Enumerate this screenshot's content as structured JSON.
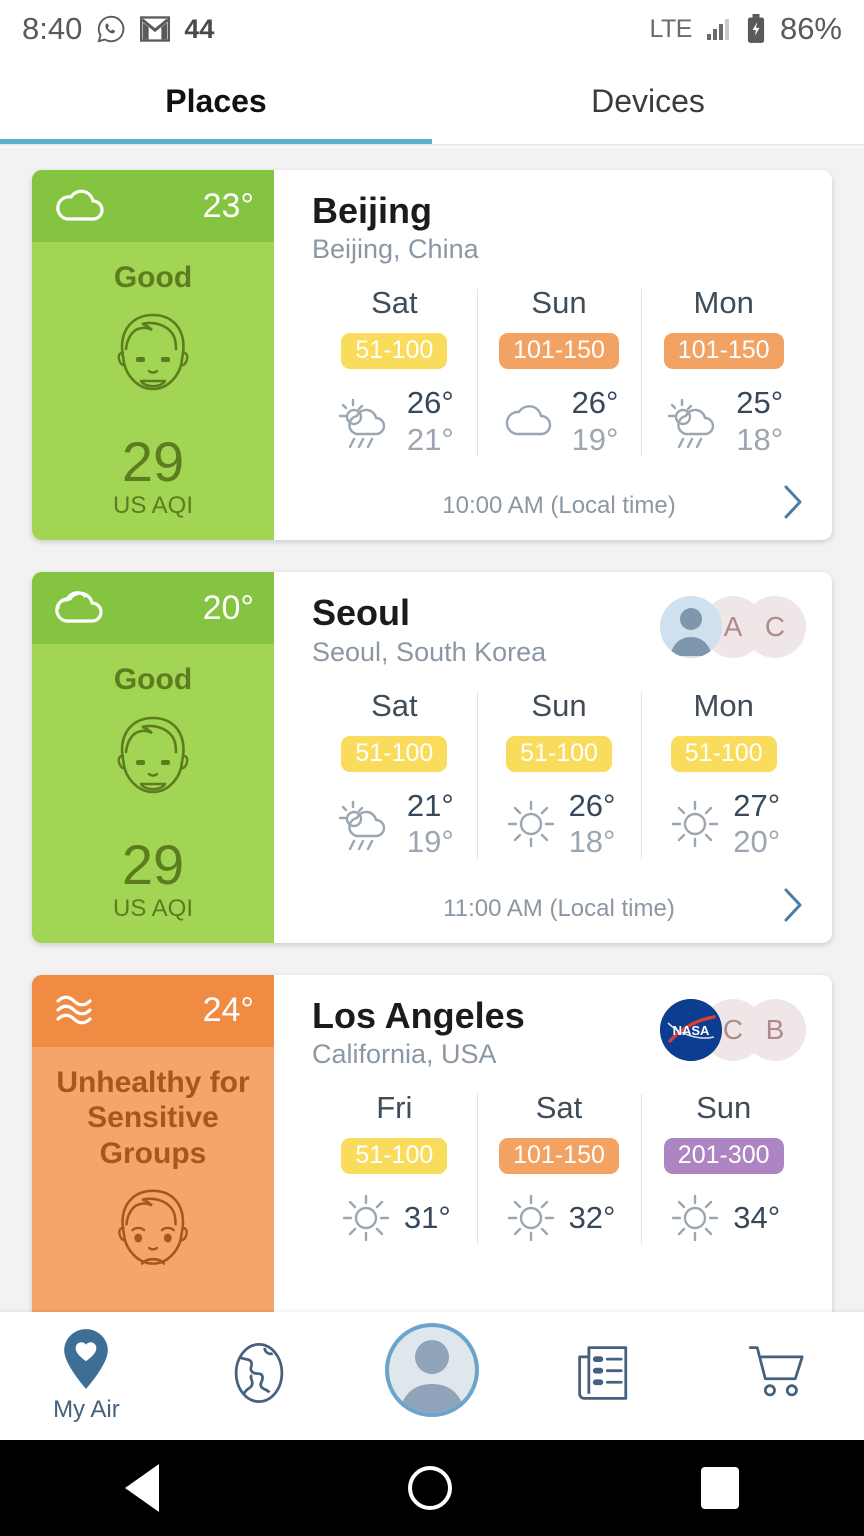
{
  "statusbar": {
    "time": "8:40",
    "notif_count": "44",
    "network": "LTE",
    "battery": "86%",
    "icons": [
      "whatsapp-icon",
      "gmail-icon",
      "signal-icon",
      "battery-charging-icon"
    ]
  },
  "tabs": [
    {
      "label": "Places",
      "active": true
    },
    {
      "label": "Devices",
      "active": false
    }
  ],
  "colors": {
    "tab_underline": "#5BAFC9",
    "good_header": "#84c440",
    "good_body": "#a2d554",
    "good_text": "#5d7c1f",
    "usg_header": "#f08b43",
    "usg_body": "#f6a56a",
    "usg_text": "#a8561d",
    "badge_yellow": "#f9dc5c",
    "badge_orange": "#f2a263",
    "badge_purple": "#ad85c2",
    "nav_blue": "#45617d"
  },
  "cards": [
    {
      "city": "Beijing",
      "region": "Beijing, China",
      "aqi": {
        "weather_icon": "cloud-icon",
        "temp": "23°",
        "label": "Good",
        "face": "happy-face-icon",
        "value": "29",
        "unit": "US AQI",
        "level": "good"
      },
      "avatars": [],
      "days": [
        {
          "name": "Sat",
          "badge": "51-100",
          "badge_color": "yellow",
          "icon": "sun-cloud-rain-icon",
          "high": "26°",
          "low": "21°"
        },
        {
          "name": "Sun",
          "badge": "101-150",
          "badge_color": "orange",
          "icon": "cloud-icon",
          "high": "26°",
          "low": "19°"
        },
        {
          "name": "Mon",
          "badge": "101-150",
          "badge_color": "orange",
          "icon": "sun-cloud-rain-icon",
          "high": "25°",
          "low": "18°"
        }
      ],
      "local_time": "10:00 AM (Local time)",
      "chevron": "chevron-right-icon"
    },
    {
      "city": "Seoul",
      "region": "Seoul, South Korea",
      "aqi": {
        "weather_icon": "sun-behind-cloud-icon",
        "temp": "20°",
        "label": "Good",
        "face": "happy-face-icon",
        "value": "29",
        "unit": "US AQI",
        "level": "good"
      },
      "avatars": [
        {
          "type": "photo",
          "text": ""
        },
        {
          "type": "ghost",
          "text": "A"
        },
        {
          "type": "ghost",
          "text": "C"
        }
      ],
      "days": [
        {
          "name": "Sat",
          "badge": "51-100",
          "badge_color": "yellow",
          "icon": "sun-cloud-rain-icon",
          "high": "21°",
          "low": "19°"
        },
        {
          "name": "Sun",
          "badge": "51-100",
          "badge_color": "yellow",
          "icon": "sun-icon",
          "high": "26°",
          "low": "18°"
        },
        {
          "name": "Mon",
          "badge": "51-100",
          "badge_color": "yellow",
          "icon": "sun-icon",
          "high": "27°",
          "low": "20°"
        }
      ],
      "local_time": "11:00 AM (Local time)",
      "chevron": "chevron-right-icon"
    },
    {
      "city": "Los Angeles",
      "region": "California, USA",
      "aqi": {
        "weather_icon": "haze-icon",
        "temp": "24°",
        "label": "Unhealthy for Sensitive Groups",
        "face": "sad-face-icon",
        "value": "",
        "unit": "",
        "level": "usg"
      },
      "avatars": [
        {
          "type": "nasa",
          "text": "NASA"
        },
        {
          "type": "ghost",
          "text": "C"
        },
        {
          "type": "ghost",
          "text": "B"
        }
      ],
      "days": [
        {
          "name": "Fri",
          "badge": "51-100",
          "badge_color": "yellow",
          "icon": "sun-icon",
          "high": "31°",
          "low": ""
        },
        {
          "name": "Sat",
          "badge": "101-150",
          "badge_color": "orange",
          "icon": "sun-icon",
          "high": "32°",
          "low": ""
        },
        {
          "name": "Sun",
          "badge": "201-300",
          "badge_color": "purple",
          "icon": "sun-icon",
          "high": "34°",
          "low": ""
        }
      ],
      "local_time": "",
      "chevron": ""
    }
  ],
  "bottom_nav": [
    {
      "icon": "location-heart-icon",
      "label": "My Air",
      "active": true
    },
    {
      "icon": "globe-icon",
      "label": "",
      "active": false
    },
    {
      "icon": "profile-avatar-icon",
      "label": "",
      "active": false
    },
    {
      "icon": "news-list-icon",
      "label": "",
      "active": false
    },
    {
      "icon": "shopping-cart-icon",
      "label": "",
      "active": false
    }
  ],
  "android_nav": [
    {
      "icon": "back-triangle-icon"
    },
    {
      "icon": "home-circle-icon"
    },
    {
      "icon": "recents-square-icon"
    }
  ]
}
